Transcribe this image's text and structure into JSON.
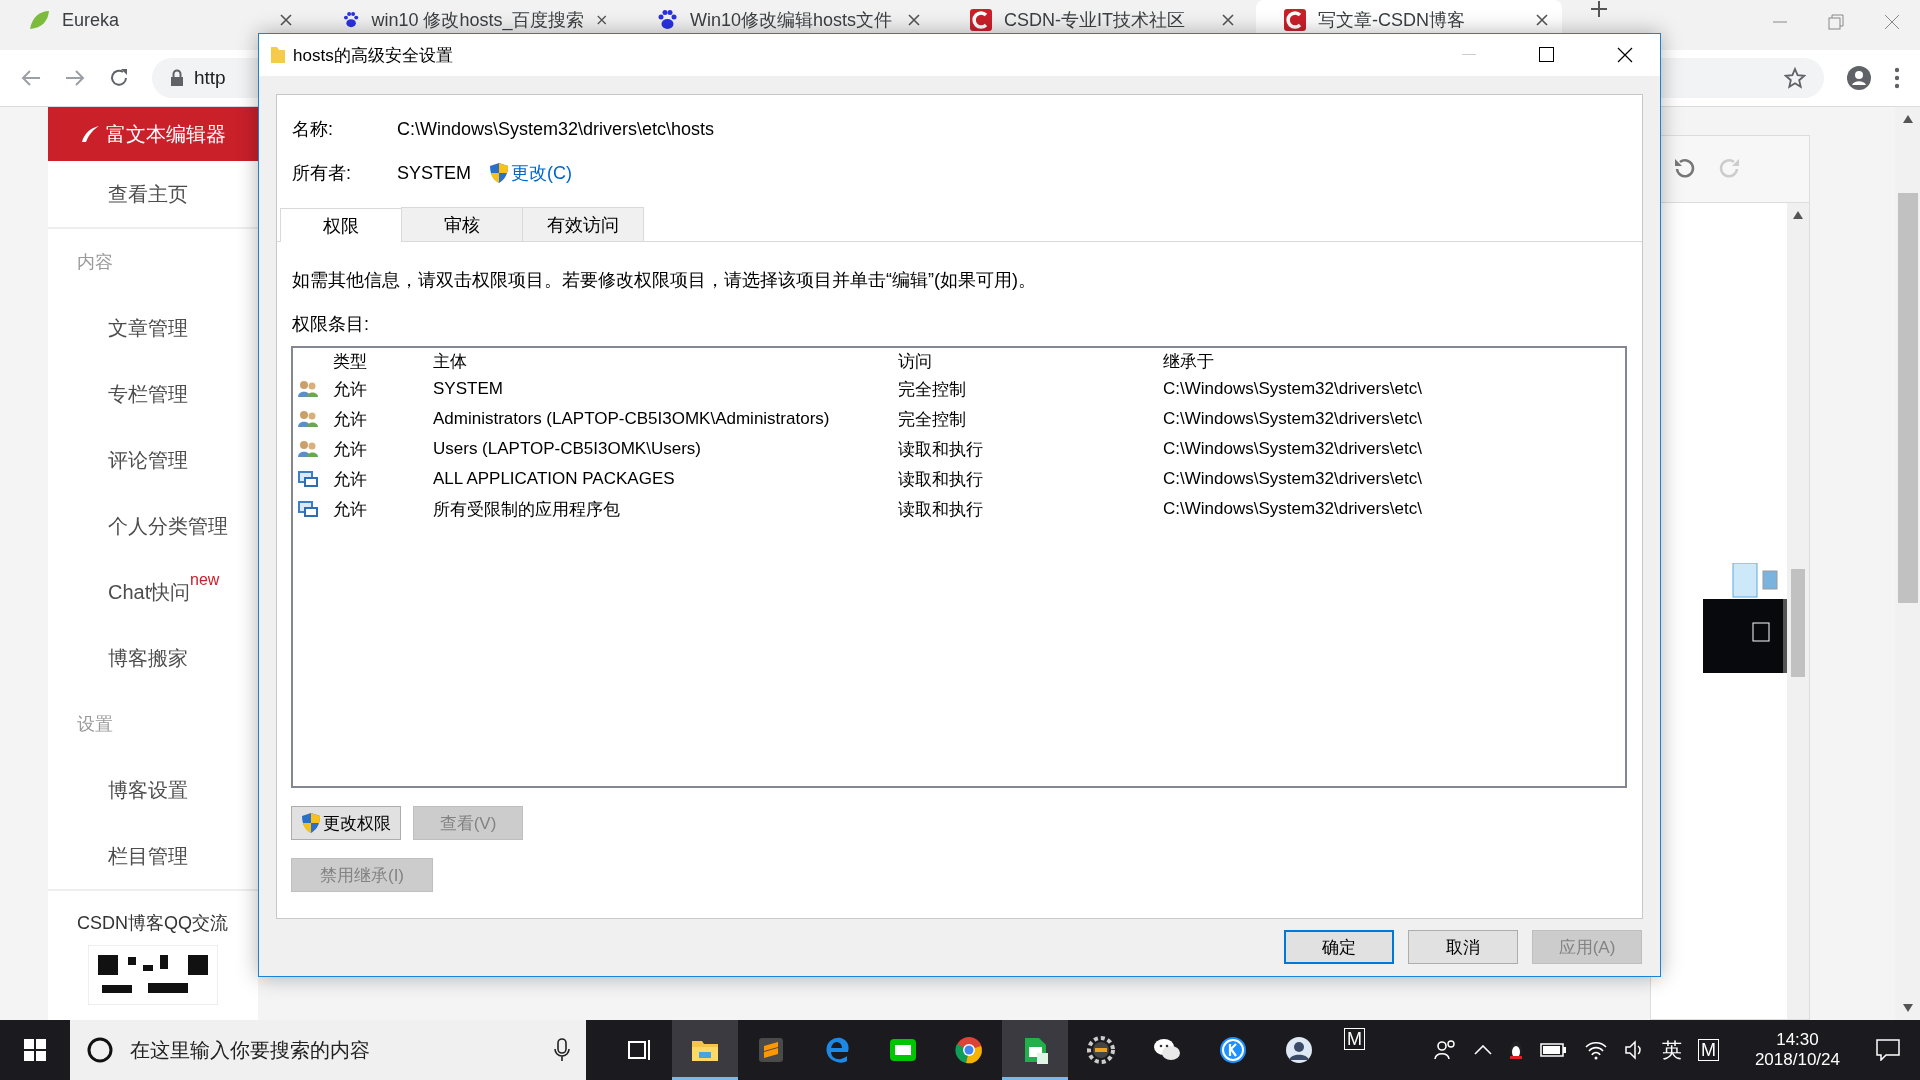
{
  "browser": {
    "tabs": [
      {
        "title": "Eureka",
        "kind": "leaf",
        "selected": false
      },
      {
        "title": "win10 修改hosts_百度搜索",
        "kind": "paw",
        "selected": false
      },
      {
        "title": "Win10修改编辑hosts文件",
        "kind": "paw",
        "selected": false
      },
      {
        "title": "CSDN-专业IT技术社区",
        "kind": "csdn",
        "selected": false
      },
      {
        "title": "写文章-CSDN博客",
        "kind": "csdn",
        "selected": true
      }
    ],
    "address": "http"
  },
  "sidebar": {
    "editor_button": "富文本编辑器",
    "items": [
      {
        "kind": "link",
        "label": "查看主页"
      },
      {
        "kind": "heading",
        "label": "内容"
      },
      {
        "kind": "link",
        "label": "文章管理"
      },
      {
        "kind": "link",
        "label": "专栏管理"
      },
      {
        "kind": "link",
        "label": "评论管理"
      },
      {
        "kind": "link",
        "label": "个人分类管理"
      },
      {
        "kind": "link",
        "label": "Chat快问",
        "badge": "new"
      },
      {
        "kind": "link",
        "label": "博客搬家"
      },
      {
        "kind": "heading",
        "label": "设置"
      },
      {
        "kind": "link",
        "label": "博客设置"
      },
      {
        "kind": "link",
        "label": "栏目管理"
      }
    ],
    "group_title": "CSDN博客QQ交流"
  },
  "dialog": {
    "title": "hosts的高级安全设置",
    "name_label": "名称:",
    "name_value": "C:\\Windows\\System32\\drivers\\etc\\hosts",
    "owner_label": "所有者:",
    "owner_value": "SYSTEM",
    "change_link": "更改(C)",
    "tabs": [
      {
        "label": "权限",
        "selected": true
      },
      {
        "label": "审核",
        "selected": false
      },
      {
        "label": "有效访问",
        "selected": false
      }
    ],
    "hint": "如需其他信息，请双击权限项目。若要修改权限项目，请选择该项目并单击“编辑”(如果可用)。",
    "entries_label": "权限条目:",
    "columns": [
      "类型",
      "主体",
      "访问",
      "继承于"
    ],
    "rows": [
      {
        "kind": "user",
        "type": "允许",
        "principal": "SYSTEM",
        "access": "完全控制",
        "inherited_from": "C:\\Windows\\System32\\drivers\\etc\\"
      },
      {
        "kind": "user",
        "type": "允许",
        "principal": "Administrators (LAPTOP-CB5I3OMK\\Administrators)",
        "access": "完全控制",
        "inherited_from": "C:\\Windows\\System32\\drivers\\etc\\"
      },
      {
        "kind": "user",
        "type": "允许",
        "principal": "Users (LAPTOP-CB5I3OMK\\Users)",
        "access": "读取和执行",
        "inherited_from": "C:\\Windows\\System32\\drivers\\etc\\"
      },
      {
        "kind": "package",
        "type": "允许",
        "principal": "ALL APPLICATION PACKAGES",
        "access": "读取和执行",
        "inherited_from": "C:\\Windows\\System32\\drivers\\etc\\"
      },
      {
        "kind": "package",
        "type": "允许",
        "principal": "所有受限制的应用程序包",
        "access": "读取和执行",
        "inherited_from": "C:\\Windows\\System32\\drivers\\etc\\"
      }
    ],
    "buttons": [
      {
        "label": "更改权限",
        "shield": true,
        "disabled": false
      },
      {
        "label": "查看(V)",
        "shield": false,
        "disabled": true
      }
    ],
    "inherit_button": {
      "label": "禁用继承(I)",
      "disabled": true
    },
    "footer_buttons": [
      {
        "label": "确定",
        "default": true,
        "disabled": false
      },
      {
        "label": "取消",
        "default": false,
        "disabled": false
      },
      {
        "label": "应用(A)",
        "default": false,
        "disabled": true
      }
    ]
  },
  "taskbar": {
    "search": {
      "placeholder": "在这里输入你要搜索的内容"
    },
    "apps": [
      {
        "kind": "taskview",
        "active": false
      },
      {
        "kind": "folder",
        "active": true
      },
      {
        "kind": "sublime",
        "active": false
      },
      {
        "kind": "edge",
        "active": false
      },
      {
        "kind": "iqiyi",
        "active": false
      },
      {
        "kind": "chrome",
        "active": false
      },
      {
        "kind": "sheet",
        "active": true
      },
      {
        "kind": "gear",
        "active": false
      },
      {
        "kind": "wechat",
        "active": false
      },
      {
        "kind": "k",
        "active": false
      },
      {
        "kind": "avatar",
        "active": false
      }
    ],
    "pinned_mark": "M",
    "language": "英",
    "ime_mark": "M",
    "time": "14:30",
    "date": "2018/10/24"
  }
}
